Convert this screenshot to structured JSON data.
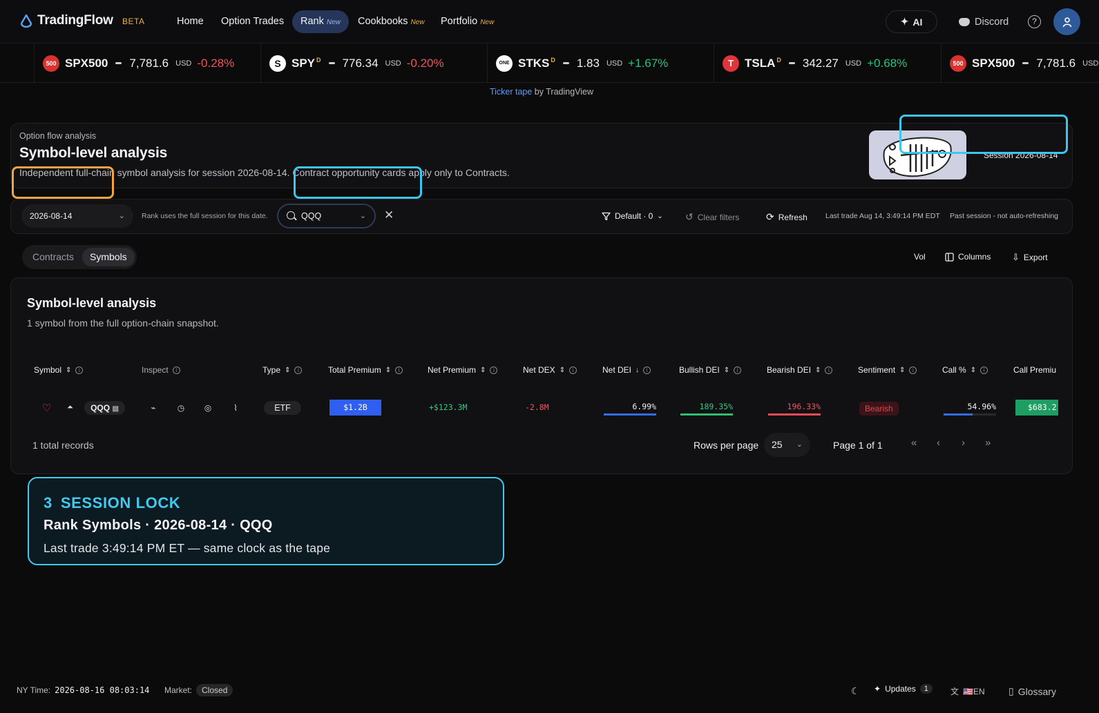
{
  "nav": {
    "brand": "TradingFlow",
    "beta": "BETA",
    "links": [
      {
        "label": "Home",
        "new": ""
      },
      {
        "label": "Option Trades",
        "new": ""
      },
      {
        "label": "Rank",
        "new": "New"
      },
      {
        "label": "Cookbooks",
        "new": "New"
      },
      {
        "label": "Portfolio",
        "new": "New"
      }
    ],
    "ai": "AI",
    "discord": "Discord",
    "help": "?"
  },
  "ticker": {
    "items": [
      {
        "badge": "500",
        "symbol": "SPX500",
        "sup": "",
        "price": "7,781.6",
        "currency": "USD",
        "change": "-0.28%",
        "dir": "down"
      },
      {
        "badge": "S",
        "symbol": "SPY",
        "sup": "D",
        "price": "776.34",
        "currency": "USD",
        "change": "-0.20%",
        "dir": "down"
      },
      {
        "badge": "ONE",
        "symbol": "STKS",
        "sup": "D",
        "price": "1.83",
        "currency": "USD",
        "change": "+1.67%",
        "dir": "up"
      },
      {
        "badge": "T",
        "symbol": "TSLA",
        "sup": "D",
        "price": "342.27",
        "currency": "USD",
        "change": "+0.68%",
        "dir": "up"
      },
      {
        "badge": "500",
        "symbol": "SPX500",
        "sup": "",
        "price": "7,781.6",
        "currency": "USD",
        "change": "",
        "dir": "down"
      }
    ],
    "credit_link": "Ticker tape",
    "credit_rest": " by TradingView"
  },
  "header": {
    "eyebrow": "Option flow analysis",
    "title": "Symbol-level analysis",
    "description": "Independent full-chain symbol analysis for session 2026-08-14. Contract opportunity cards apply only to Contracts.",
    "session": "Session 2026-08-14"
  },
  "filters": {
    "date": "2026-08-14",
    "rank_note": "Rank uses the full session for this date.",
    "symbol": "QQQ",
    "preset": "Default · 0",
    "clear": "Clear filters",
    "refresh": "Refresh",
    "last_trade": "Last trade Aug 14, 3:49:14 PM EDT",
    "session_state": "Past session - not auto-refreshing"
  },
  "tabs": {
    "contracts": "Contracts",
    "symbols": "Symbols"
  },
  "toolbar": {
    "vol": "Vol",
    "columns": "Columns",
    "export": "Export"
  },
  "table": {
    "title": "Symbol-level analysis",
    "subtitle": "1 symbol from the full option-chain snapshot.",
    "columns": [
      "Symbol",
      "Inspect",
      "Type",
      "Total Premium",
      "Net Premium",
      "Net DEX",
      "Net DEI",
      "Bullish DEI",
      "Bearish DEI",
      "Sentiment",
      "Call %",
      "Call Premiu"
    ],
    "row": {
      "symbol": "QQQ",
      "type": "ETF",
      "total_premium": "$1.2B",
      "net_premium": "+$123.3M",
      "net_dex": "-2.8M",
      "net_dei": "6.99%",
      "bullish_dei": "189.35%",
      "bearish_dei": "196.33%",
      "sentiment": "Bearish",
      "call_pct": "54.96%",
      "call_premium": "$683.2"
    },
    "bars": {
      "net_dei": 1.0,
      "bullish_dei": 1.0,
      "bearish_dei": 1.0,
      "call_pct": 0.55
    },
    "colors": {
      "blue": "#2f6ef0",
      "green": "#2fbf71",
      "red": "#f04c5a",
      "heat_blue": "#2f5ff0",
      "heat_green": "#1f9e63"
    },
    "total_records": "1 total records",
    "rows_per_page_label": "Rows per page",
    "rows_per_page": "25",
    "page": "Page 1 of 1"
  },
  "callout": {
    "number": "3",
    "heading": "SESSION LOCK",
    "line2": "Rank Symbols · 2026-08-14 · QQQ",
    "line3": "Last trade 3:49:14 PM ET — same clock as the tape"
  },
  "status": {
    "ny_label": "NY Time:",
    "ny_time": "2026-08-16 08:03:14",
    "market_label": "Market:",
    "market": "Closed",
    "updates": "Updates",
    "updates_count": "1",
    "lang": "🇺🇸EN",
    "glossary": "Glossary"
  }
}
